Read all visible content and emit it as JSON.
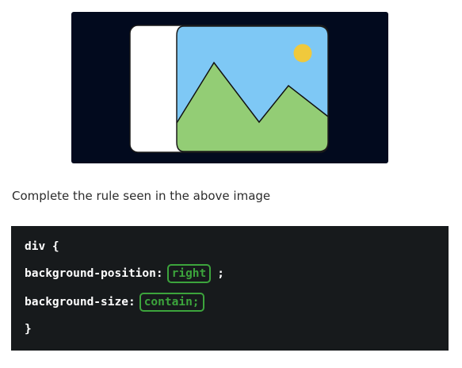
{
  "preview": {
    "icon": "image-landscape-icon",
    "colors": {
      "background": "#020a1e",
      "sky": "#7ec8f5",
      "mountains": "#93cd75",
      "sun": "#f0c93c"
    }
  },
  "prompt": "Complete the rule seen in the above image",
  "code": {
    "open": "div {",
    "prop1": "background-position:",
    "answer1": "right",
    "after1": ";",
    "prop2": "background-size:",
    "answer2": "contain;",
    "close": "}"
  }
}
